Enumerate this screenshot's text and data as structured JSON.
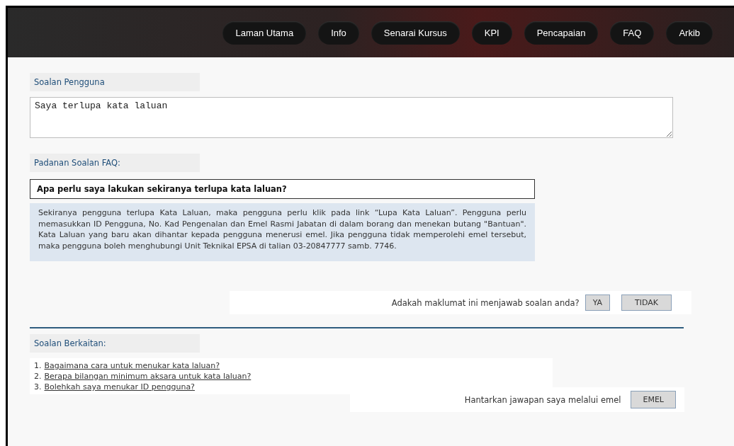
{
  "nav": {
    "items": [
      {
        "label": "Laman Utama"
      },
      {
        "label": "Info"
      },
      {
        "label": "Senarai Kursus"
      },
      {
        "label": "KPI"
      },
      {
        "label": "Pencapaian"
      },
      {
        "label": "FAQ"
      },
      {
        "label": "Arkib"
      }
    ]
  },
  "user_question": {
    "heading": "Soalan Pengguna",
    "value": "Saya terlupa kata laluan"
  },
  "faq_match": {
    "heading": "Padanan Soalan FAQ:",
    "question": "Apa perlu saya lakukan sekiranya terlupa kata laluan?",
    "answer": "Sekiranya pengguna terlupa Kata Laluan, maka pengguna perlu klik pada link “Lupa Kata Laluan”. Pengguna perlu memasukkan ID Pengguna, No. Kad Pengenalan dan Emel Rasmi Jabatan di dalam borang dan menekan butang \"Bantuan\". Kata Laluan yang baru akan dihantar kepada pengguna menerusi emel. Jika pengguna tidak memperolehi emel tersebut, maka pengguna boleh menghubungi Unit Teknikal EPSA di talian 03-20847777 samb. 7746."
  },
  "feedback": {
    "prompt": "Adakah maklumat ini menjawab soalan anda?",
    "buttons": [
      "YA",
      "TIDAK"
    ]
  },
  "related": {
    "heading": "Soalan Berkaitan:",
    "items": [
      {
        "number": "1.",
        "label": "Bagaimana cara untuk menukar kata laluan?"
      },
      {
        "number": "2.",
        "label": "Berapa bilangan minimum aksara untuk kata laluan?"
      },
      {
        "number": "3.",
        "label": "Bolehkah saya menukar ID pengguna?"
      }
    ]
  },
  "email": {
    "prompt": "Hantarkan jawapan saya melalui emel",
    "button": "EMEL"
  }
}
